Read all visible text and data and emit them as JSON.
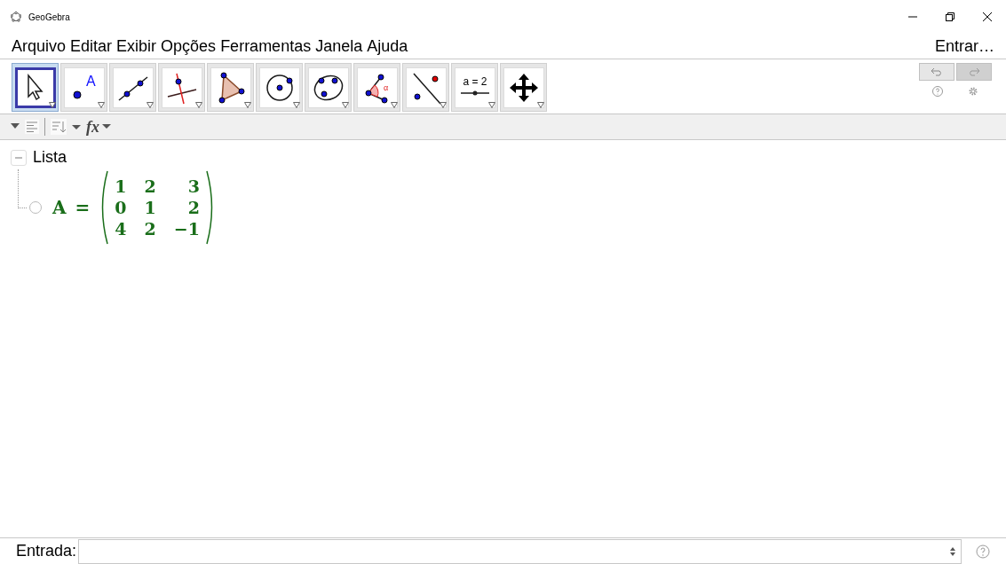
{
  "window": {
    "title": "GeoGebra"
  },
  "menu": [
    "Arquivo",
    "Editar",
    "Exibir",
    "Opções",
    "Ferramentas",
    "Janela",
    "Ajuda"
  ],
  "sign_in": "Entrar…",
  "tools": [
    {
      "kind": "move",
      "selected": true
    },
    {
      "kind": "point",
      "label": "A",
      "selected": false
    },
    {
      "kind": "line",
      "selected": false
    },
    {
      "kind": "perpendicular",
      "selected": false
    },
    {
      "kind": "polygon",
      "selected": false
    },
    {
      "kind": "circle",
      "selected": false
    },
    {
      "kind": "conic",
      "selected": false
    },
    {
      "kind": "angle",
      "label": "α",
      "selected": false
    },
    {
      "kind": "reflect",
      "selected": false
    },
    {
      "kind": "slider",
      "label": "a = 2",
      "selected": false
    },
    {
      "kind": "move_view",
      "selected": false
    }
  ],
  "undo": {
    "disabled": false
  },
  "redo": {
    "disabled": true
  },
  "algebra_toolbar": {
    "fx": "fx"
  },
  "algebra": {
    "group": {
      "label": "Lista",
      "expanded": true,
      "items": [
        {
          "name": "A",
          "equals": "=",
          "visible": false,
          "matrix": [
            [
              "1",
              "2",
              "3"
            ],
            [
              "0",
              "1",
              "2"
            ],
            [
              "4",
              "2",
              "−1"
            ]
          ]
        }
      ]
    }
  },
  "input_bar": {
    "label": "Entrada:"
  }
}
